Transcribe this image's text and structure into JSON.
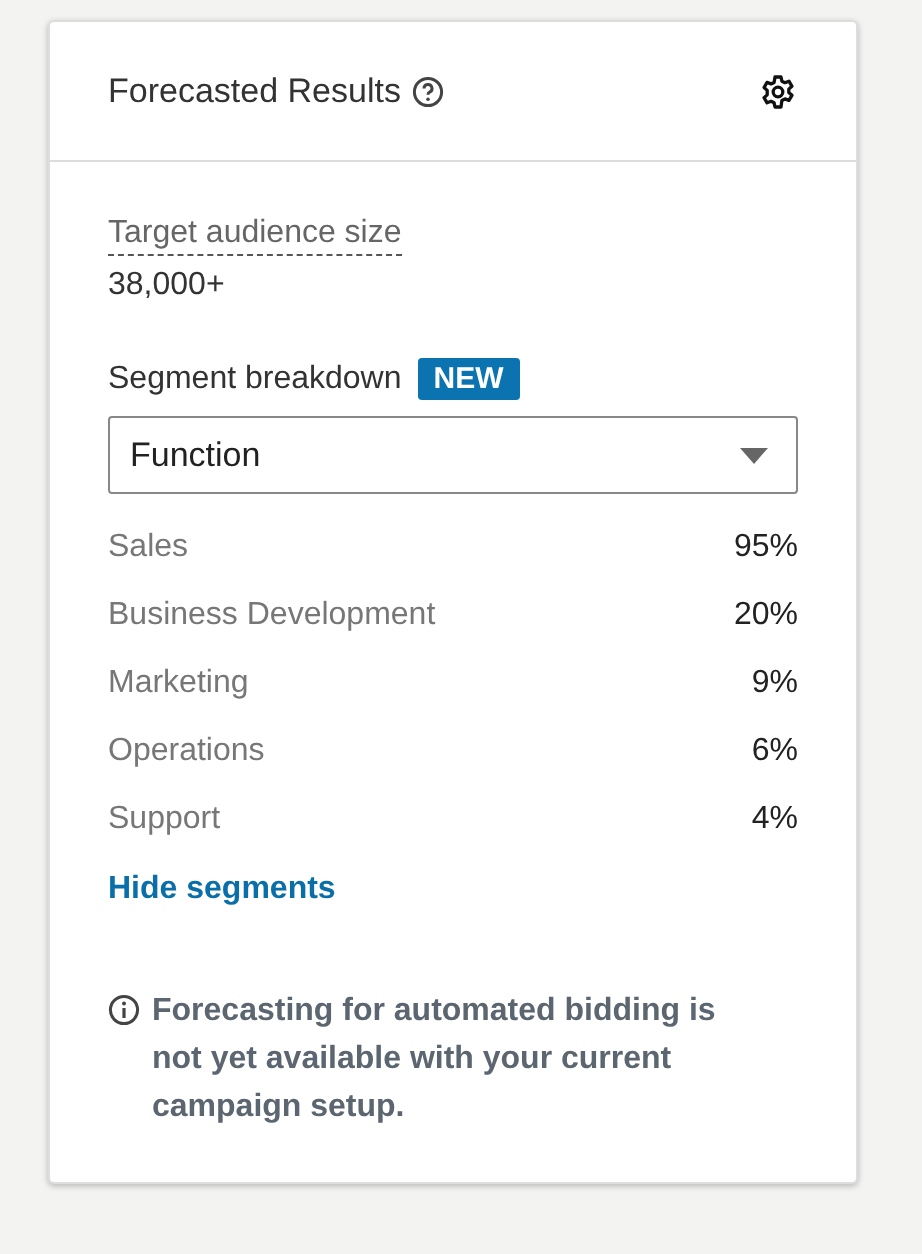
{
  "card": {
    "title": "Forecasted Results"
  },
  "audience": {
    "label": "Target audience size",
    "value": "38,000+"
  },
  "segment": {
    "label": "Segment breakdown",
    "badge": "NEW",
    "dropdown": {
      "value": "Function"
    }
  },
  "segments": [
    {
      "name": "Sales",
      "percent": "95%"
    },
    {
      "name": "Business Development",
      "percent": "20%"
    },
    {
      "name": "Marketing",
      "percent": "9%"
    },
    {
      "name": "Operations",
      "percent": "6%"
    },
    {
      "name": "Support",
      "percent": "4%"
    }
  ],
  "toggle_link": "Hide segments",
  "note": "Forecasting for automated bidding is not yet available with your current campaign setup."
}
